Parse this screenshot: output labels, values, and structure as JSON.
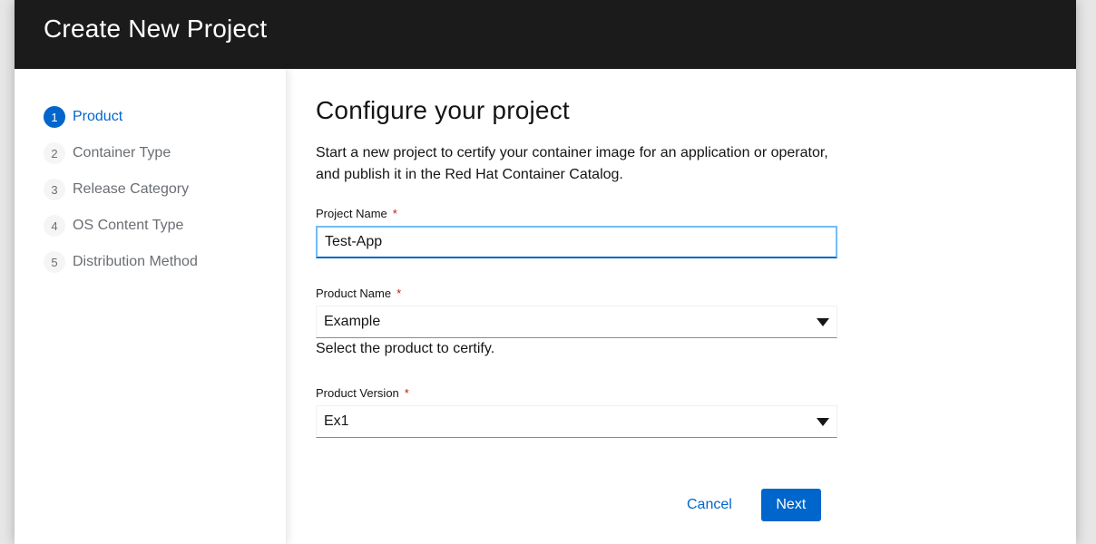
{
  "header": {
    "title": "Create New Project"
  },
  "nav": {
    "items": [
      {
        "num": "1",
        "label": "Product",
        "current": true
      },
      {
        "num": "2",
        "label": "Container Type",
        "current": false
      },
      {
        "num": "3",
        "label": "Release Category",
        "current": false
      },
      {
        "num": "4",
        "label": "OS Content Type",
        "current": false
      },
      {
        "num": "5",
        "label": "Distribution Method",
        "current": false
      }
    ]
  },
  "main": {
    "title": "Configure your project",
    "description": "Start a new project to certify your container image for an application or operator, and publish it in the Red Hat Container Catalog.",
    "project_name": {
      "label": "Project Name",
      "required": "*",
      "value": "Test-App"
    },
    "product_name": {
      "label": "Product Name",
      "required": "*",
      "value": "Example",
      "helper": "Select the product to certify.",
      "icon": "caret-down-icon"
    },
    "product_version": {
      "label": "Product Version",
      "required": "*",
      "value": "Ex1",
      "icon": "caret-down-icon"
    }
  },
  "actions": {
    "cancel": "Cancel",
    "next": "Next"
  },
  "colors": {
    "accent": "#0066cc",
    "header_bg": "#1b1b1b",
    "required": "#c9190b"
  }
}
